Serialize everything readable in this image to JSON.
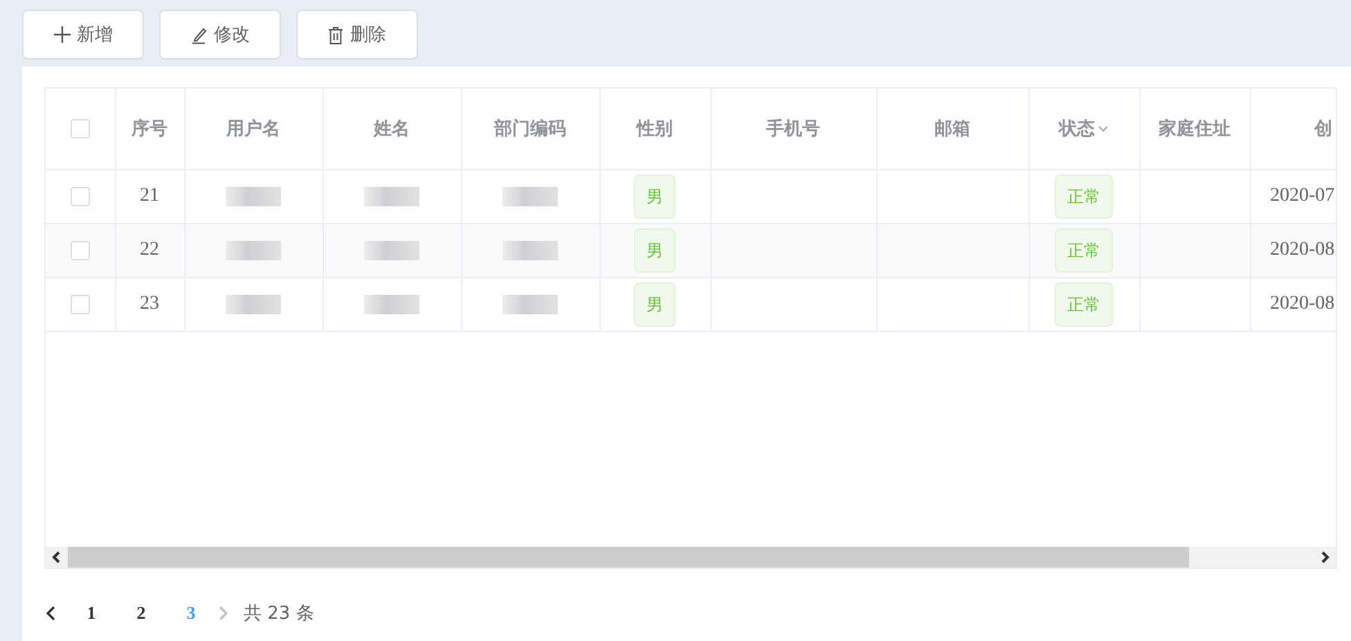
{
  "toolbar": [
    {
      "label": "新增",
      "kind": "add"
    },
    {
      "label": "修改",
      "kind": "edit"
    },
    {
      "label": "删除",
      "kind": "delete"
    }
  ],
  "table": {
    "columns": [
      {
        "kind": "check"
      },
      {
        "label": "序号",
        "kind": "text"
      },
      {
        "label": "用户名",
        "kind": "blur"
      },
      {
        "label": "姓名",
        "kind": "blur"
      },
      {
        "label": "部门编码",
        "kind": "blur"
      },
      {
        "label": "性别",
        "kind": "tag"
      },
      {
        "label": "手机号",
        "kind": "text"
      },
      {
        "label": "邮箱",
        "kind": "text"
      },
      {
        "label": "状态",
        "kind": "tag",
        "sortable": true
      },
      {
        "label": "家庭住址",
        "kind": "text"
      },
      {
        "label": "创",
        "kind": "edge"
      }
    ],
    "header_checked": false,
    "rows": [
      {
        "checked": false,
        "cells": [
          "",
          "21",
          "",
          "",
          "",
          "男",
          "",
          "",
          "正常",
          "",
          "2020-07"
        ]
      },
      {
        "checked": false,
        "cells": [
          "",
          "22",
          "",
          "",
          "",
          "男",
          "",
          "",
          "正常",
          "",
          "2020-08"
        ]
      },
      {
        "checked": false,
        "cells": [
          "",
          "23",
          "",
          "",
          "",
          "男",
          "",
          "",
          "正常",
          "",
          "2020-08"
        ]
      }
    ]
  },
  "pagination": {
    "prev_disabled": false,
    "next_disabled": true,
    "pages": [
      {
        "label": "1",
        "selected": false
      },
      {
        "label": "2",
        "selected": false
      },
      {
        "label": "3",
        "selected": true
      }
    ],
    "total": "共 23 条"
  }
}
